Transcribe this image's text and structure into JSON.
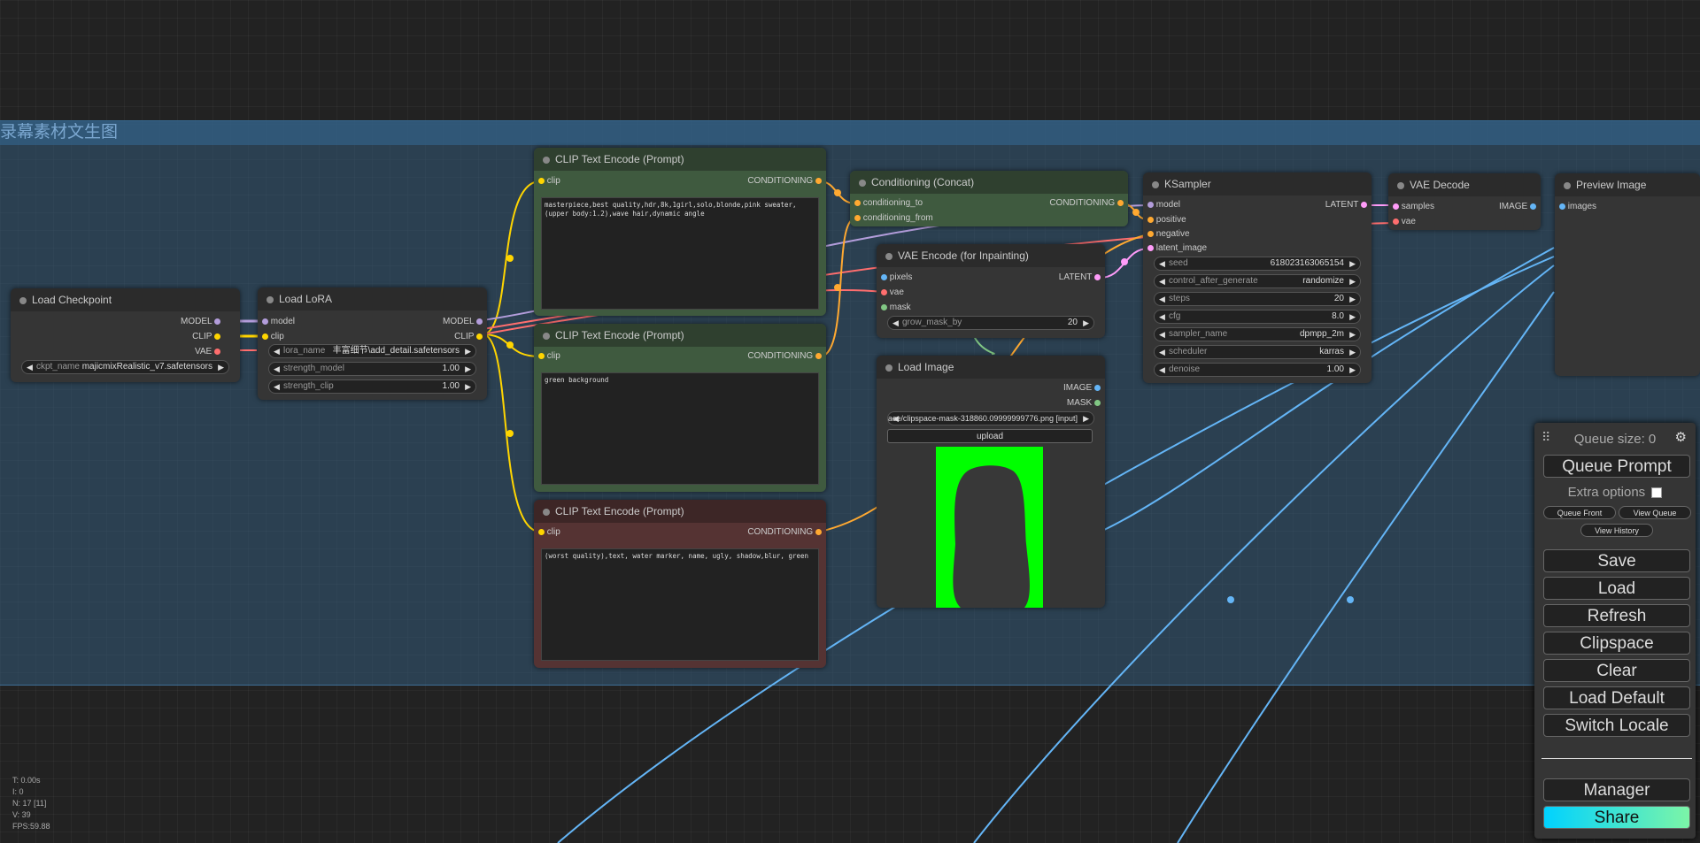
{
  "group": {
    "title": "录幕素材文生图"
  },
  "nodes": {
    "load_checkpoint": {
      "title": "Load Checkpoint",
      "outputs": [
        "MODEL",
        "CLIP",
        "VAE"
      ],
      "ckpt_label": "ckpt_name",
      "ckpt_value": "majicmixRealistic_v7.safetensors"
    },
    "load_lora": {
      "title": "Load LoRA",
      "inputs": [
        "model",
        "clip"
      ],
      "outputs": [
        "MODEL",
        "CLIP"
      ],
      "widgets": [
        {
          "label": "lora_name",
          "value": "丰富细节\\add_detail.safetensors"
        },
        {
          "label": "strength_model",
          "value": "1.00"
        },
        {
          "label": "strength_clip",
          "value": "1.00"
        }
      ]
    },
    "clip_pos": {
      "title": "CLIP Text Encode (Prompt)",
      "input": "clip",
      "output": "CONDITIONING",
      "text": "masterpiece,best quality,hdr,8k,1girl,solo,blonde,pink sweater,(upper body:1.2),wave hair,dynamic angle"
    },
    "clip_bg": {
      "title": "CLIP Text Encode (Prompt)",
      "input": "clip",
      "output": "CONDITIONING",
      "text": "green background"
    },
    "clip_neg": {
      "title": "CLIP Text Encode (Prompt)",
      "input": "clip",
      "output": "CONDITIONING",
      "text": "(worst quality),text, water marker, name, ugly, shadow,blur, green"
    },
    "concat": {
      "title": "Conditioning (Concat)",
      "inputs": [
        "conditioning_to",
        "conditioning_from"
      ],
      "output": "CONDITIONING"
    },
    "vae_encode": {
      "title": "VAE Encode (for Inpainting)",
      "inputs": [
        "pixels",
        "vae",
        "mask"
      ],
      "output": "LATENT",
      "widget_label": "grow_mask_by",
      "widget_value": "20"
    },
    "load_image": {
      "title": "Load Image",
      "outputs": [
        "IMAGE",
        "MASK"
      ],
      "image_value": "clipspace/clipspace-mask-318860.09999999776.png [input]",
      "upload": "upload"
    },
    "ksampler": {
      "title": "KSampler",
      "inputs": [
        "model",
        "positive",
        "negative",
        "latent_image"
      ],
      "output": "LATENT",
      "widgets": [
        {
          "label": "seed",
          "value": "618023163065154"
        },
        {
          "label": "control_after_generate",
          "value": "randomize"
        },
        {
          "label": "steps",
          "value": "20"
        },
        {
          "label": "cfg",
          "value": "8.0"
        },
        {
          "label": "sampler_name",
          "value": "dpmpp_2m"
        },
        {
          "label": "scheduler",
          "value": "karras"
        },
        {
          "label": "denoise",
          "value": "1.00"
        }
      ]
    },
    "vae_decode": {
      "title": "VAE Decode",
      "inputs": [
        "samples",
        "vae"
      ],
      "output": "IMAGE"
    },
    "preview": {
      "title": "Preview Image",
      "input": "images"
    }
  },
  "menu": {
    "queue_size": "Queue size: 0",
    "queue_prompt": "Queue Prompt",
    "extra_options": "Extra options",
    "queue_front": "Queue Front",
    "view_queue": "View Queue",
    "view_history": "View History",
    "save": "Save",
    "load": "Load",
    "refresh": "Refresh",
    "clipspace": "Clipspace",
    "clear": "Clear",
    "load_default": "Load Default",
    "switch_locale": "Switch Locale",
    "manager": "Manager",
    "share": "Share"
  },
  "stats": {
    "t": "T: 0.00s",
    "i": "I: 0",
    "n": "N: 17 [11]",
    "v": "V: 39",
    "fps": "FPS:59.88"
  },
  "colors": {
    "clip": "#ffd500",
    "model": "#b39ddb",
    "vae": "#ff6e6e",
    "conditioning": "#ffa931",
    "latent": "#ff9cf9",
    "image": "#64b5f6",
    "mask": "#81c784"
  }
}
